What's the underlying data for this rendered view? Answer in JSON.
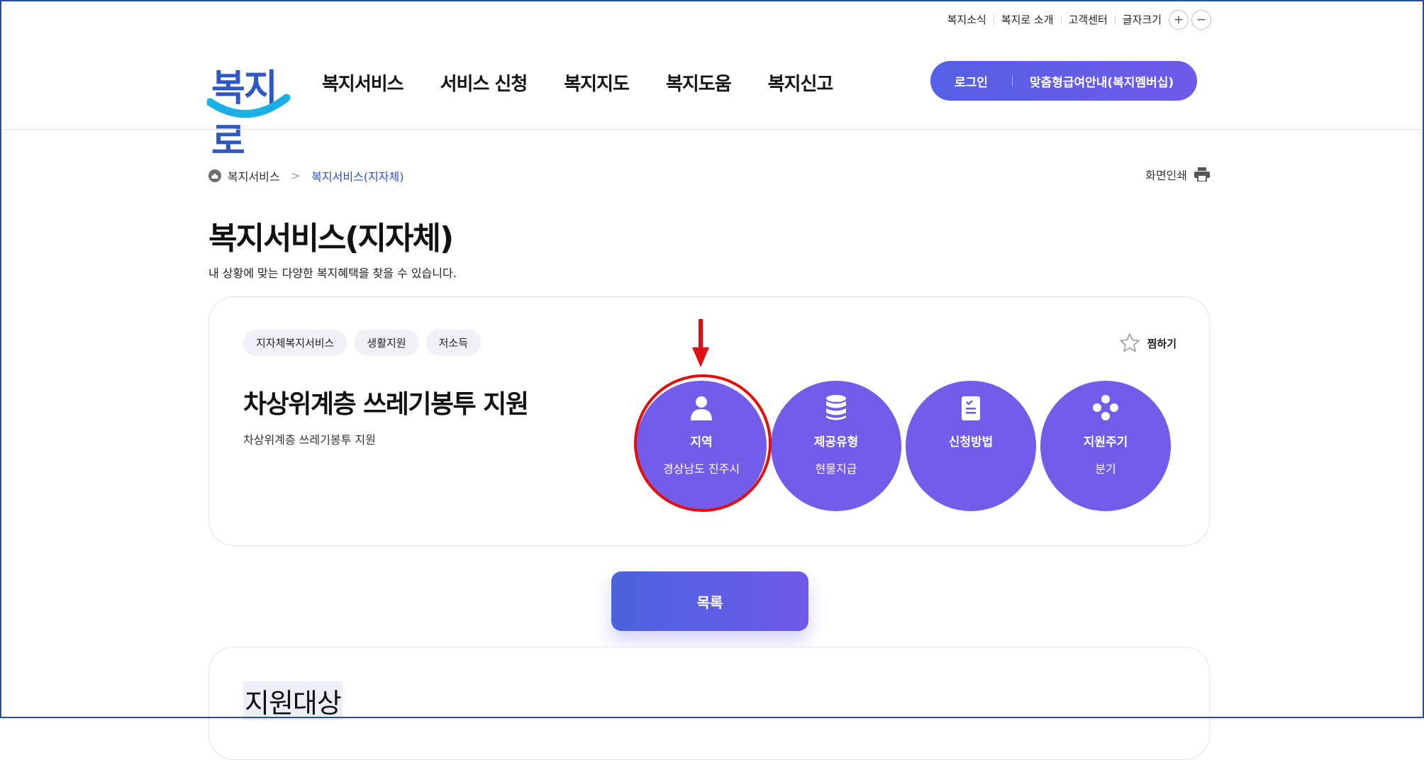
{
  "util_nav": {
    "links": [
      "복지소식",
      "복지로 소개",
      "고객센터"
    ],
    "font_size_label": "글자크기",
    "plus": "+",
    "minus": "−"
  },
  "logo": {
    "text": "복지로",
    "icon": "bokjiro-smile-logo"
  },
  "gnb": [
    "복지서비스",
    "서비스 신청",
    "복지지도",
    "복지도움",
    "복지신고"
  ],
  "login": {
    "login_label": "로그인",
    "membership_label": "맞춤형급여안내(복지멤버십)"
  },
  "breadcrumb": {
    "home_icon": "home-icon",
    "parent": "복지서비스",
    "separator": ">",
    "current": "복지서비스(지자체)"
  },
  "print": {
    "label": "화면인쇄",
    "icon": "printer-icon"
  },
  "page": {
    "title": "복지서비스(지자체)",
    "description": "내 상황에 맞는 다양한 복지혜택을 찾을 수 있습니다."
  },
  "service": {
    "tags": [
      "지자체복지서비스",
      "생활지원",
      "저소득"
    ],
    "favorite_label": "찜하기",
    "title": "차상위계층 쓰레기봉투 지원",
    "description": "차상위계층 쓰레기봉투 지원",
    "info": [
      {
        "label": "지역",
        "value": "경상남도 진주시",
        "icon": "person-icon"
      },
      {
        "label": "제공유형",
        "value": "현물지급",
        "icon": "database-icon"
      },
      {
        "label": "신청방법",
        "value": "",
        "icon": "clipboard-icon"
      },
      {
        "label": "지원주기",
        "value": "분기",
        "icon": "diamond-dots-icon"
      }
    ]
  },
  "list_button": "목록",
  "section": {
    "title": "지원대상"
  },
  "colors": {
    "accent": "#745cea",
    "highlight": "#e01010",
    "link": "#2d52c8"
  }
}
